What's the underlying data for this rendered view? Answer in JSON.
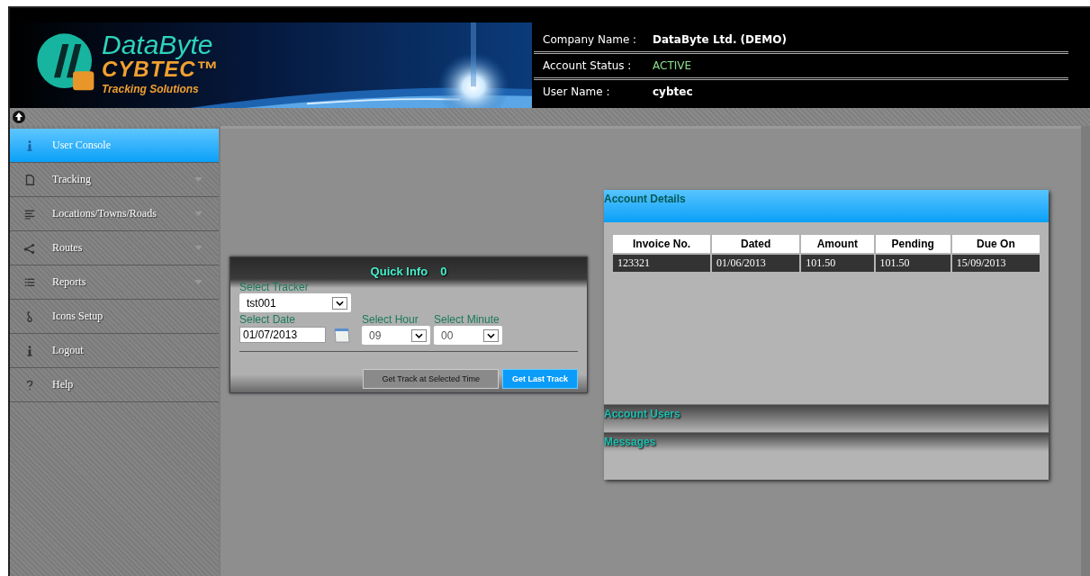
{
  "header": {
    "logo": {
      "name": "DataByte",
      "product": "CYBTEC™",
      "tagline": "Tracking Solutions"
    },
    "info": [
      {
        "label": "Company Name :",
        "value": "DataByte Ltd. (DEMO)",
        "kind": "bold"
      },
      {
        "label": "Account Status :",
        "value": "ACTIVE",
        "kind": "status"
      },
      {
        "label": "User Name :",
        "value": "cybtec",
        "kind": "bold"
      }
    ]
  },
  "sidebar": {
    "items": [
      {
        "label": "User Console",
        "selected": true,
        "expandable": false
      },
      {
        "label": "Tracking",
        "selected": false,
        "expandable": true
      },
      {
        "label": "Locations/Towns/Roads",
        "selected": false,
        "expandable": true
      },
      {
        "label": "Routes",
        "selected": false,
        "expandable": true
      },
      {
        "label": "Reports",
        "selected": false,
        "expandable": true
      },
      {
        "label": "Icons Setup",
        "selected": false,
        "expandable": false
      },
      {
        "label": "Logout",
        "selected": false,
        "expandable": false
      },
      {
        "label": "Help",
        "selected": false,
        "expandable": false
      }
    ]
  },
  "quick_info": {
    "title": "Quick Info",
    "count": "0",
    "tracker": {
      "label": "Select Tracker",
      "value": "tst001"
    },
    "date": {
      "label": "Select Date",
      "value": "01/07/2013"
    },
    "hour": {
      "label": "Select Hour",
      "value": "09"
    },
    "minute": {
      "label": "Select Minute",
      "value": "00"
    },
    "buttons": [
      {
        "label": "Get Track at Selected Time",
        "kind": "normal"
      },
      {
        "label": "Get Last Track",
        "kind": "primary"
      }
    ]
  },
  "account_details": {
    "title": "Account Details",
    "table": {
      "columns": [
        "Invoice No.",
        "Dated",
        "Amount",
        "Pending",
        "Due On"
      ],
      "rows": [
        [
          "123321",
          "01/06/2013",
          "101.50",
          "101.50",
          "15/09/2013"
        ]
      ]
    }
  },
  "sections": [
    {
      "title": "Account Users"
    },
    {
      "title": "Messages"
    }
  ]
}
